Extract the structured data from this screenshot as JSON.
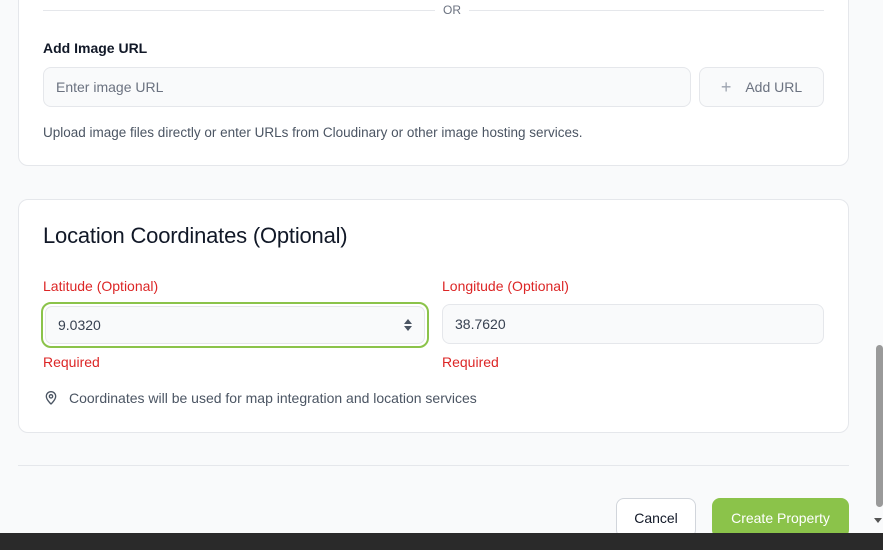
{
  "image_section": {
    "or_text": "OR",
    "add_image_url_label": "Add Image URL",
    "url_placeholder": "Enter image URL",
    "add_url_button": "Add URL",
    "help_text": "Upload image files directly or enter URLs from Cloudinary or other image hosting services."
  },
  "location": {
    "title": "Location Coordinates (Optional)",
    "latitude": {
      "label": "Latitude (Optional)",
      "value": "9.0320",
      "error": "Required"
    },
    "longitude": {
      "label": "Longitude (Optional)",
      "value": "38.7620",
      "error": "Required"
    },
    "note": "Coordinates will be used for map integration and location services"
  },
  "actions": {
    "cancel": "Cancel",
    "create": "Create Property"
  },
  "colors": {
    "accent": "#8bc34a",
    "error": "#dc2626"
  }
}
